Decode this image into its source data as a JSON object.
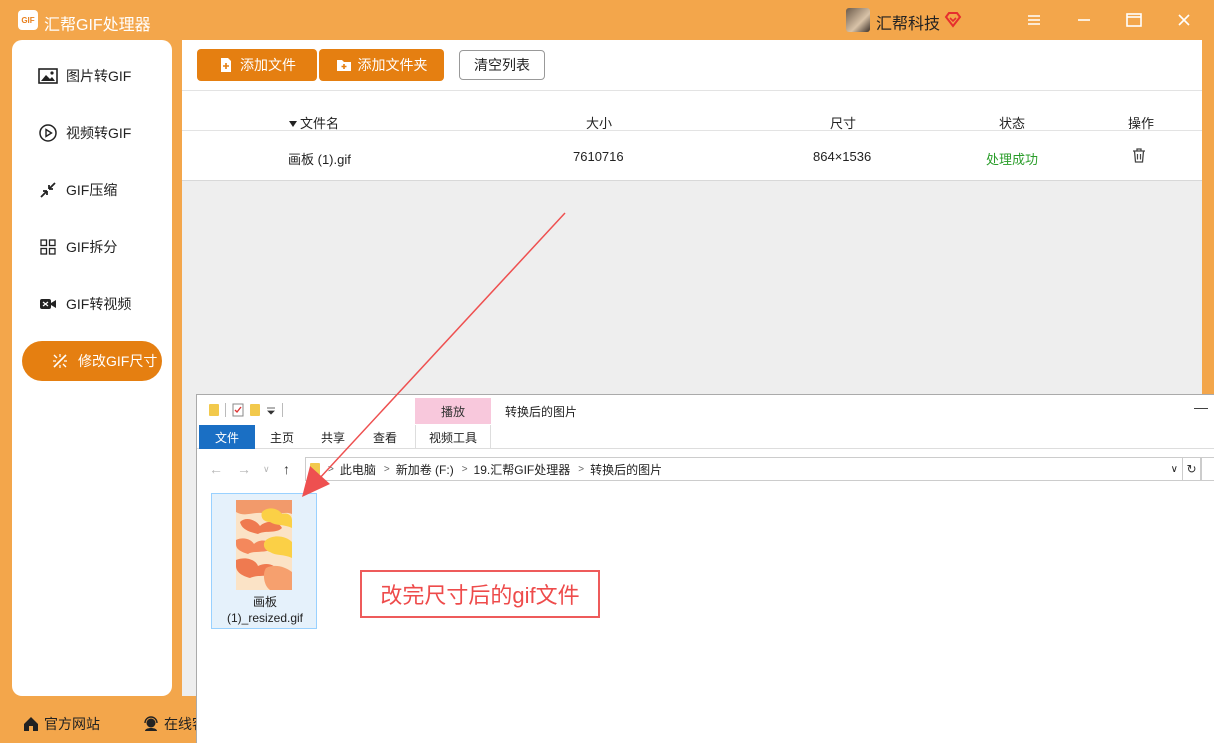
{
  "app": {
    "logo_text": "GIF",
    "title": "汇帮GIF处理器",
    "user_name": "汇帮科技"
  },
  "sidebar": {
    "items": [
      {
        "label": "图片转GIF",
        "icon": "image-icon"
      },
      {
        "label": "视频转GIF",
        "icon": "play-icon"
      },
      {
        "label": "GIF压缩",
        "icon": "compress-icon"
      },
      {
        "label": "GIF拆分",
        "icon": "split-icon"
      },
      {
        "label": "GIF转视频",
        "icon": "video-camera-icon"
      },
      {
        "label": "修改GIF尺寸",
        "icon": "resize-icon",
        "active": true
      }
    ]
  },
  "bottom": {
    "website": "官方网站",
    "online": "在线客"
  },
  "toolbar": {
    "add_file": "添加文件",
    "add_folder": "添加文件夹",
    "clear_list": "清空列表"
  },
  "table": {
    "columns": {
      "name": "文件名",
      "size": "大小",
      "dims": "尺寸",
      "status": "状态",
      "action": "操作"
    },
    "rows": [
      {
        "name": "画板 (1).gif",
        "size": "7610716",
        "dims": "864×1536",
        "status": "处理成功"
      }
    ]
  },
  "explorer": {
    "contextual_tab": "播放",
    "title": "转换后的图片",
    "tabs": {
      "file": "文件",
      "home": "主页",
      "share": "共享",
      "view": "查看",
      "video_tools": "视频工具"
    },
    "breadcrumbs": [
      "此电脑",
      "新加卷 (F:)",
      "19.汇帮GIF处理器",
      "转换后的图片"
    ],
    "file": {
      "name_line1": "画板",
      "name_line2": "(1)_resized.gif"
    }
  },
  "annotation": {
    "text": "改完尺寸后的gif文件"
  },
  "colors": {
    "brand": "#e57f11",
    "background": "#f3a64b",
    "success": "#2a9d2a",
    "annotation": "#ee4b4b"
  }
}
